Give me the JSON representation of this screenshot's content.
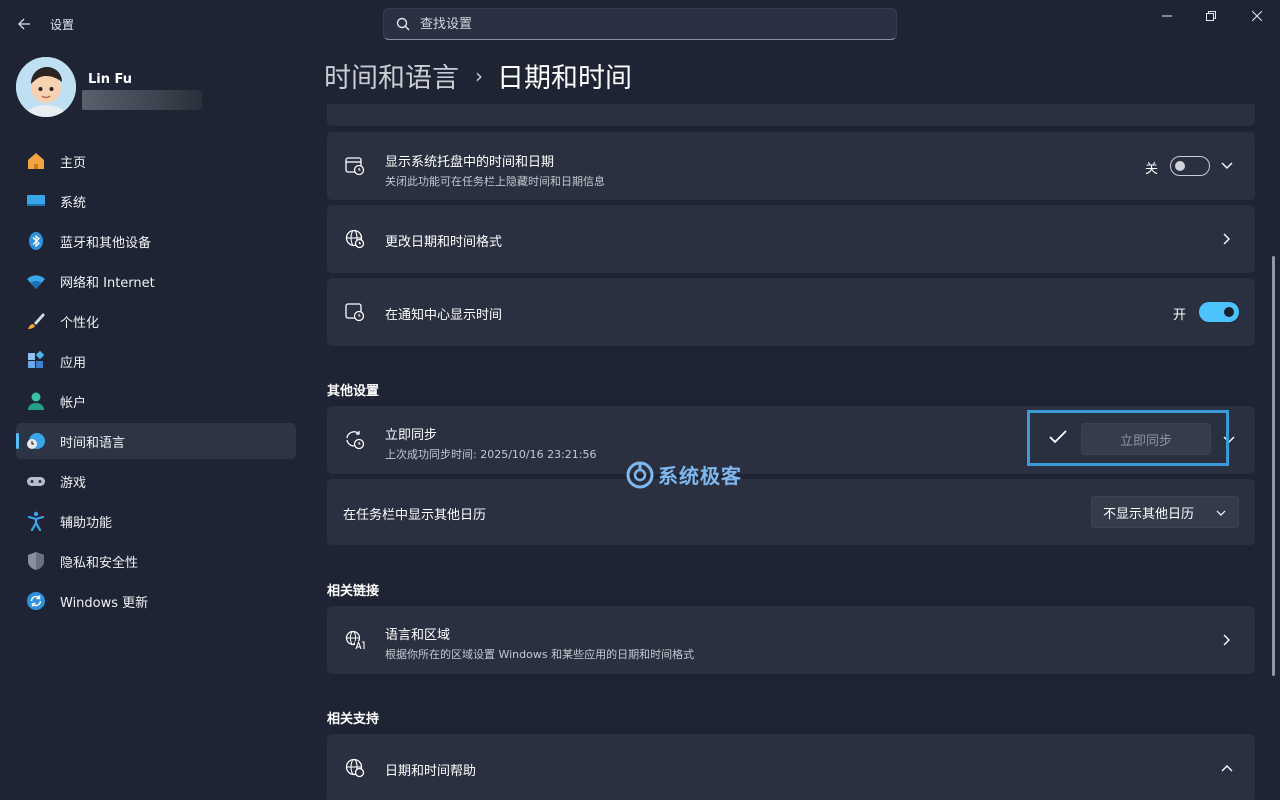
{
  "window": {
    "title": "设置",
    "search_placeholder": "查找设置"
  },
  "user": {
    "name": "Lin Fu"
  },
  "sidebar": {
    "items": [
      {
        "label": "主页",
        "icon": "home-icon"
      },
      {
        "label": "系统",
        "icon": "system-icon"
      },
      {
        "label": "蓝牙和其他设备",
        "icon": "bluetooth-icon"
      },
      {
        "label": "网络和 Internet",
        "icon": "wifi-icon"
      },
      {
        "label": "个性化",
        "icon": "brush-icon"
      },
      {
        "label": "应用",
        "icon": "apps-icon"
      },
      {
        "label": "帐户",
        "icon": "account-icon"
      },
      {
        "label": "时间和语言",
        "icon": "time-language-icon",
        "active": true
      },
      {
        "label": "游戏",
        "icon": "gamepad-icon"
      },
      {
        "label": "辅助功能",
        "icon": "accessibility-icon"
      },
      {
        "label": "隐私和安全性",
        "icon": "shield-icon"
      },
      {
        "label": "Windows 更新",
        "icon": "update-icon"
      }
    ]
  },
  "header": {
    "parent": "时间和语言",
    "separator": "›",
    "current": "日期和时间"
  },
  "cards": {
    "tray": {
      "title": "显示系统托盘中的时间和日期",
      "subtitle": "关闭此功能可在任务栏上隐藏时间和日期信息",
      "state_label": "关",
      "enabled": false
    },
    "format": {
      "title": "更改日期和时间格式"
    },
    "notify": {
      "title": "在通知中心显示时间",
      "state_label": "开",
      "enabled": true
    }
  },
  "other_settings": {
    "section_title": "其他设置",
    "sync": {
      "title": "立即同步",
      "subtitle": "上次成功同步时间: 2025/10/16 23:21:56",
      "button_label": "立即同步"
    },
    "calendar": {
      "title": "在任务栏中显示其他日历",
      "selected": "不显示其他日历"
    }
  },
  "related_links": {
    "section_title": "相关链接",
    "region": {
      "title": "语言和区域",
      "subtitle": "根据你所在的区域设置 Windows 和某些应用的日期和时间格式"
    }
  },
  "related_support": {
    "section_title": "相关支持",
    "help": {
      "title": "日期和时间帮助"
    }
  },
  "watermark": {
    "text": "系统极客"
  },
  "colors": {
    "background": "#1e2433",
    "card": "#2a3040",
    "accent": "#4cc2ff",
    "highlight_box": "#3b9bd6"
  }
}
